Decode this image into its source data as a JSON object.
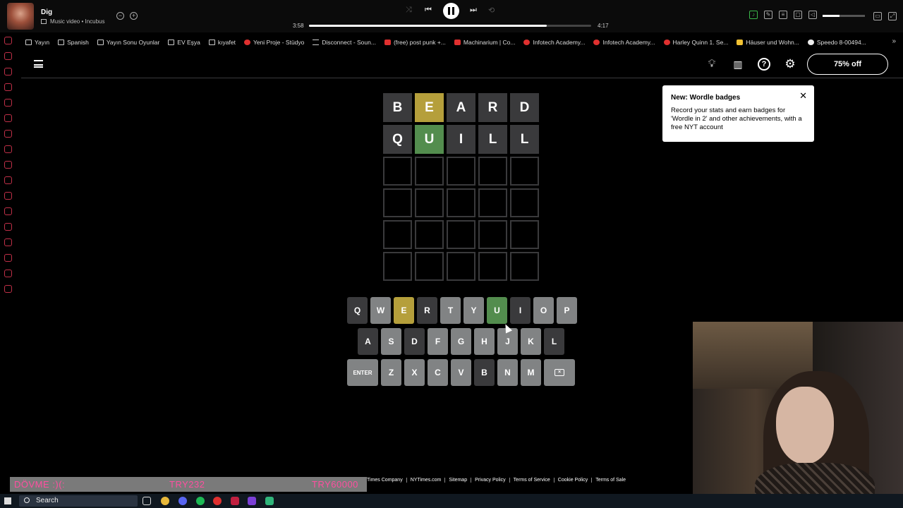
{
  "media": {
    "title": "Dig",
    "subtitle": "Music video • Incubus",
    "elapsed": "3:58",
    "duration": "4:17",
    "progress_fraction": 0.842,
    "volume_fraction": 0.4
  },
  "bookmarks": [
    {
      "label": "Yayın",
      "icon": "folder-icon"
    },
    {
      "label": "Spanish",
      "icon": "folder-icon"
    },
    {
      "label": "Yayın Sonu Oyunlar",
      "icon": "folder-icon"
    },
    {
      "label": "EV Eşya",
      "icon": "folder-icon"
    },
    {
      "label": "kıyafet",
      "icon": "folder-icon"
    },
    {
      "label": "Yeni Proje - Stüdyo",
      "icon": "red-circle-icon"
    },
    {
      "label": "Disconnect - Soun...",
      "icon": "link-icon"
    },
    {
      "label": "(free) post punk +...",
      "icon": "youtube-icon"
    },
    {
      "label": "Machinarium | Co...",
      "icon": "youtube-icon"
    },
    {
      "label": "Infotech Academy...",
      "icon": "red-circle-icon"
    },
    {
      "label": "Infotech Academy...",
      "icon": "red-circle-icon"
    },
    {
      "label": "Harley Quinn 1. Se...",
      "icon": "red-circle-icon"
    },
    {
      "label": "Häuser und Wohn...",
      "icon": "yellow-icon"
    },
    {
      "label": "Speedo 8-00494...",
      "icon": "white-icon"
    }
  ],
  "header": {
    "offer_label": "75% off"
  },
  "board": {
    "rows": [
      [
        {
          "letter": "B",
          "state": "absent"
        },
        {
          "letter": "E",
          "state": "present"
        },
        {
          "letter": "A",
          "state": "absent"
        },
        {
          "letter": "R",
          "state": "absent"
        },
        {
          "letter": "D",
          "state": "absent"
        }
      ],
      [
        {
          "letter": "Q",
          "state": "absent"
        },
        {
          "letter": "U",
          "state": "correct"
        },
        {
          "letter": "I",
          "state": "absent"
        },
        {
          "letter": "L",
          "state": "absent"
        },
        {
          "letter": "L",
          "state": "absent"
        }
      ],
      [
        {
          "letter": "",
          "state": "empty"
        },
        {
          "letter": "",
          "state": "empty"
        },
        {
          "letter": "",
          "state": "empty"
        },
        {
          "letter": "",
          "state": "empty"
        },
        {
          "letter": "",
          "state": "empty"
        }
      ],
      [
        {
          "letter": "",
          "state": "empty"
        },
        {
          "letter": "",
          "state": "empty"
        },
        {
          "letter": "",
          "state": "empty"
        },
        {
          "letter": "",
          "state": "empty"
        },
        {
          "letter": "",
          "state": "empty"
        }
      ],
      [
        {
          "letter": "",
          "state": "empty"
        },
        {
          "letter": "",
          "state": "empty"
        },
        {
          "letter": "",
          "state": "empty"
        },
        {
          "letter": "",
          "state": "empty"
        },
        {
          "letter": "",
          "state": "empty"
        }
      ],
      [
        {
          "letter": "",
          "state": "empty"
        },
        {
          "letter": "",
          "state": "empty"
        },
        {
          "letter": "",
          "state": "empty"
        },
        {
          "letter": "",
          "state": "empty"
        },
        {
          "letter": "",
          "state": "empty"
        }
      ]
    ]
  },
  "keyboard": {
    "row1": [
      {
        "key": "Q",
        "state": "absent"
      },
      {
        "key": "W",
        "state": "unused"
      },
      {
        "key": "E",
        "state": "present"
      },
      {
        "key": "R",
        "state": "absent"
      },
      {
        "key": "T",
        "state": "unused"
      },
      {
        "key": "Y",
        "state": "unused"
      },
      {
        "key": "U",
        "state": "correct"
      },
      {
        "key": "I",
        "state": "absent"
      },
      {
        "key": "O",
        "state": "unused"
      },
      {
        "key": "P",
        "state": "unused"
      }
    ],
    "row2": [
      {
        "key": "A",
        "state": "absent"
      },
      {
        "key": "S",
        "state": "unused"
      },
      {
        "key": "D",
        "state": "absent"
      },
      {
        "key": "F",
        "state": "unused"
      },
      {
        "key": "G",
        "state": "unused"
      },
      {
        "key": "H",
        "state": "unused"
      },
      {
        "key": "J",
        "state": "unused"
      },
      {
        "key": "K",
        "state": "unused"
      },
      {
        "key": "L",
        "state": "absent"
      }
    ],
    "row3": [
      {
        "key": "ENTER",
        "state": "unused",
        "wide": true
      },
      {
        "key": "Z",
        "state": "unused"
      },
      {
        "key": "X",
        "state": "unused"
      },
      {
        "key": "C",
        "state": "unused"
      },
      {
        "key": "V",
        "state": "unused"
      },
      {
        "key": "B",
        "state": "absent"
      },
      {
        "key": "N",
        "state": "unused"
      },
      {
        "key": "M",
        "state": "unused"
      },
      {
        "key": "",
        "state": "unused",
        "back": true
      }
    ]
  },
  "tooltip": {
    "title": "New: Wordle badges",
    "body": "Record your stats and earn badges for 'Wordle in 2' and other achievements, with a free NYT account"
  },
  "ticker": {
    "left": "DÖVME :)(:",
    "middle": "TRY232",
    "right": "TRY60000"
  },
  "footer_links": [
    "Times Company",
    "NYTimes.com",
    "Sitemap",
    "Privacy Policy",
    "Terms of Service",
    "Cookie Policy",
    "Terms of Sale"
  ],
  "taskbar": {
    "search_label": "Search"
  },
  "colors": {
    "correct": "#538d4e",
    "present": "#b59f3b",
    "absent": "#3a3a3c",
    "unused": "#818384",
    "ticker_text": "#ff4fa0"
  }
}
